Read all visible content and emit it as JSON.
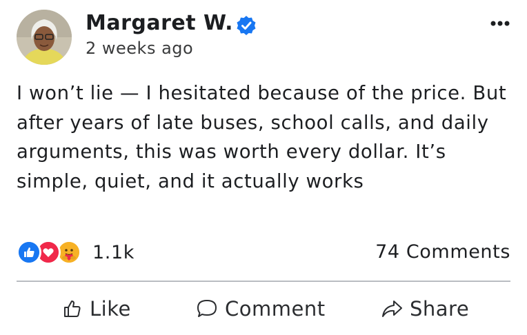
{
  "post": {
    "author": "Margaret W.",
    "time": "2 weeks ago",
    "text": "I won’t lie — I hesitated because of the price. But after years of late buses, school calls, and daily arguments, this was worth every dollar. It’s simple, quiet, and it actually works"
  },
  "reactions": {
    "count": "1.1k",
    "icons": [
      "like-icon",
      "love-icon",
      "care-icon"
    ]
  },
  "comments": {
    "label": "74 Comments"
  },
  "actions": {
    "like_label": "Like",
    "comment_label": "Comment",
    "share_label": "Share"
  },
  "colors": {
    "verified": "#1877f2",
    "like": "#1877f2",
    "love": "#f0284a",
    "care": "#f7b125",
    "divider": "#b9bcc1"
  }
}
